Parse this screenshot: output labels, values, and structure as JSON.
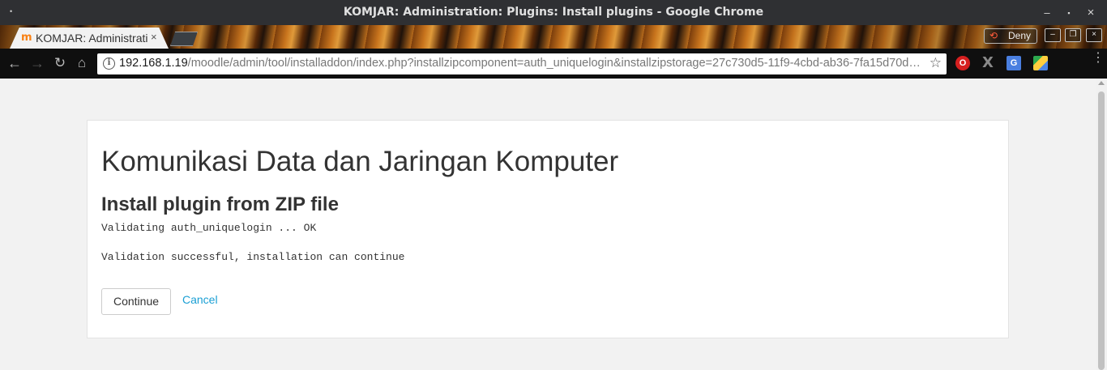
{
  "window": {
    "title": "KOMJAR: Administration: Plugins: Install plugins - Google Chrome",
    "menu_glyph": "•",
    "min_glyph": "–",
    "max_glyph": "▪",
    "close_glyph": "×"
  },
  "tabs": [
    {
      "favicon": "m",
      "label": "KOMJAR: Administration: Plugins: Install plugins",
      "close": "×",
      "active": true
    }
  ],
  "tabstrip": {
    "deny_label": "Deny",
    "deny_icon": "⟲",
    "min_glyph": "–",
    "restore_glyph": "❐",
    "close_glyph": "×"
  },
  "toolbar": {
    "back_glyph": "←",
    "forward_glyph": "→",
    "reload_glyph": "↻",
    "home_glyph": "⌂",
    "info_glyph": "i",
    "url_host": "192.168.1.19",
    "url_path": "/moodle/admin/tool/installaddon/index.php?installzipcomponent=auth_uniquelogin&installzipstorage=27c730d5-11f9-4cbd-ab36-7fa15d70d…",
    "star_glyph": "☆",
    "extensions": [
      {
        "name": "opera-icon",
        "glyph": "O"
      },
      {
        "name": "x-icon",
        "glyph": "X"
      },
      {
        "name": "translate-icon",
        "glyph": "G"
      },
      {
        "name": "google-drive-icon",
        "glyph": ""
      }
    ],
    "menu_glyph": "⋮"
  },
  "page": {
    "site_title": "Komunikasi Data dan Jaringan Komputer",
    "heading": "Install plugin from ZIP file",
    "lines": [
      "Validating auth_uniquelogin ... OK",
      "Validation successful, installation can continue"
    ],
    "continue_label": "Continue",
    "cancel_label": "Cancel"
  },
  "colors": {
    "accent_link": "#1a9fd4",
    "moodle_orange": "#f98012",
    "titlebar": "#2f3033"
  }
}
